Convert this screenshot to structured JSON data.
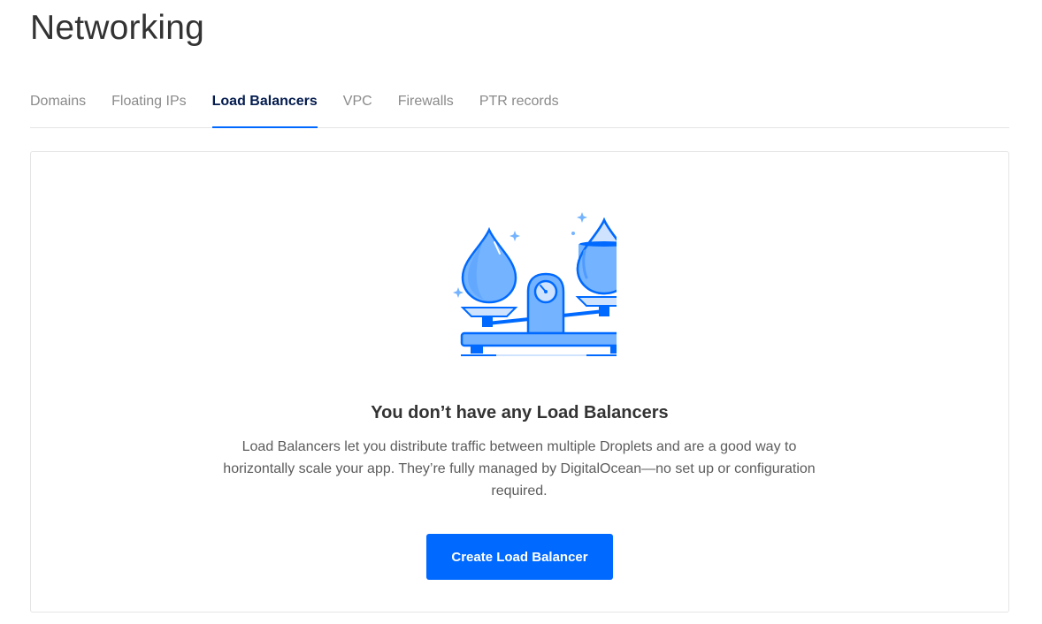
{
  "page": {
    "title": "Networking"
  },
  "tabs": [
    {
      "label": "Domains",
      "active": false
    },
    {
      "label": "Floating IPs",
      "active": false
    },
    {
      "label": "Load Balancers",
      "active": true
    },
    {
      "label": "VPC",
      "active": false
    },
    {
      "label": "Firewalls",
      "active": false
    },
    {
      "label": "PTR records",
      "active": false
    }
  ],
  "empty_state": {
    "illustration_icon": "scale-with-droplets-icon",
    "title": "You don’t have any Load Balancers",
    "description": "Load Balancers let you distribute traffic between multiple Droplets and are a good way to horizontally scale your app. They’re fully managed by DigitalOcean—no set up or configuration required.",
    "button_label": "Create Load Balancer"
  },
  "colors": {
    "accent": "#0069ff",
    "active_tab_text": "#031b4e",
    "inactive_tab_text": "#8a8a8a",
    "illustration_light": "#74b3ff",
    "illustration_pale": "#cfe3ff"
  }
}
